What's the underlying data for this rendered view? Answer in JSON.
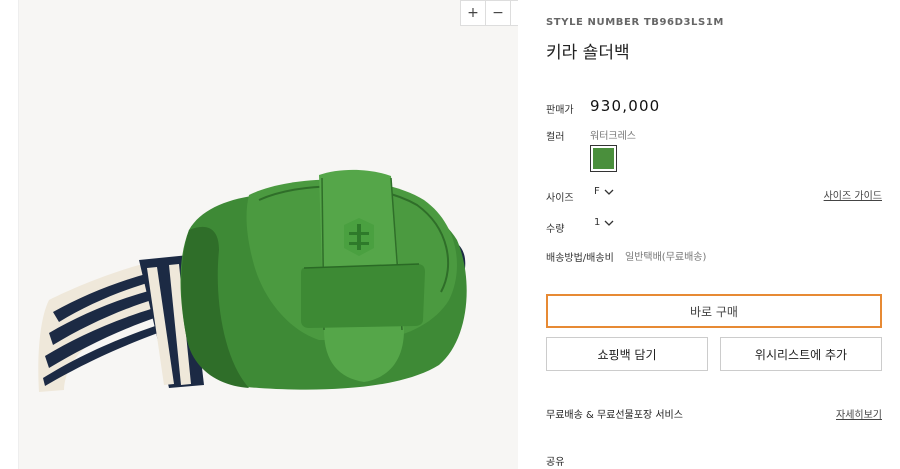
{
  "zoom_controls": {
    "zoom_in": "+",
    "zoom_out": "−",
    "fullscreen_icon": "expand-icon"
  },
  "product": {
    "style_number": "STYLE NUMBER TB96D3LS1M",
    "name": "키라 숄더백",
    "price_label": "판매가",
    "price": "930,000",
    "color_label": "컬러",
    "color_value": "워터크레스",
    "swatch_color": "#4a8f3c",
    "size_label": "사이즈",
    "size_value": "F",
    "size_guide": "사이즈 가이드",
    "quantity_label": "수량",
    "quantity_value": "1",
    "shipping_label": "배송방법/배송비",
    "shipping_value": "일반택배(무료배송)"
  },
  "actions": {
    "buy_now": "바로 구매",
    "add_to_bag": "쇼핑백 담기",
    "add_to_wishlist": "위시리스트에 추가",
    "accent_color": "#e78a34"
  },
  "service": {
    "label": "무료배송 & 무료선물포장 서비스",
    "details_link": "자세히보기"
  },
  "share_label": "공유"
}
